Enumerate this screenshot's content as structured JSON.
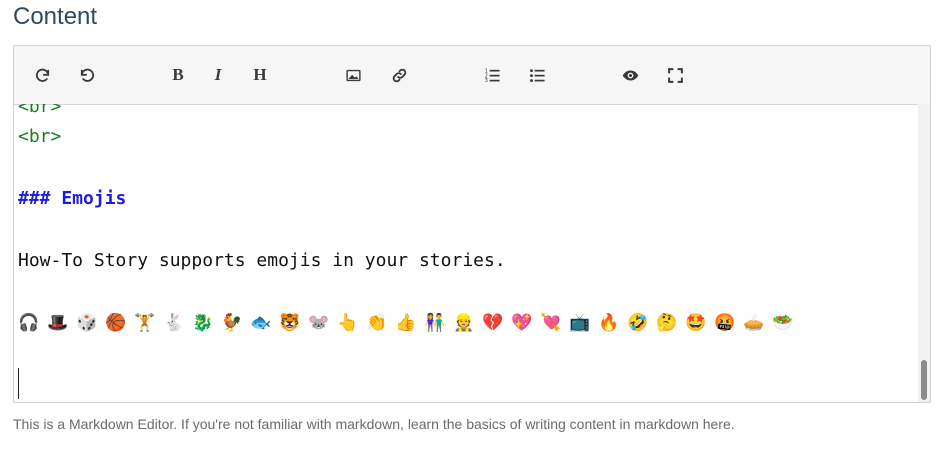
{
  "section": {
    "title": "Content"
  },
  "toolbar": {
    "items": [
      {
        "name": "redo",
        "icon": "redo-icon"
      },
      {
        "name": "undo",
        "icon": "undo-icon"
      },
      {
        "name": "bold",
        "label": "B"
      },
      {
        "name": "italic",
        "label": "I"
      },
      {
        "name": "heading",
        "label": "H"
      },
      {
        "name": "image",
        "icon": "image-icon"
      },
      {
        "name": "link",
        "icon": "link-icon"
      },
      {
        "name": "ordered-list",
        "icon": "ordered-list-icon"
      },
      {
        "name": "unordered-list",
        "icon": "unordered-list-icon"
      },
      {
        "name": "preview",
        "icon": "eye-icon"
      },
      {
        "name": "fullscreen",
        "icon": "fullscreen-icon"
      }
    ]
  },
  "editor": {
    "lines": {
      "br_partial": "<br>",
      "br": "<br>",
      "heading": "### Emojis",
      "paragraph": "How-To Story supports emojis in your stories."
    },
    "emojis": [
      "🎧",
      "🎩",
      "🎲",
      "🏀",
      "🏋",
      "🐇",
      "🐉",
      "🐓",
      "🐟",
      "🐯",
      "🐭",
      "👆",
      "👏",
      "👍",
      "👫",
      "👷",
      "💔",
      "💖",
      "💘",
      "📺",
      "🔥",
      "🤣",
      "🤔",
      "🤩",
      "🤬",
      "🥧",
      "🥗"
    ]
  },
  "help_text": "This is a Markdown Editor. If you're not familiar with markdown, learn the basics of writing content in markdown here.",
  "colors": {
    "title": "#2f4a60",
    "tag": "#1a7f1a",
    "heading": "#1d1ddb",
    "toolbar_bg": "#f6f6f6"
  }
}
